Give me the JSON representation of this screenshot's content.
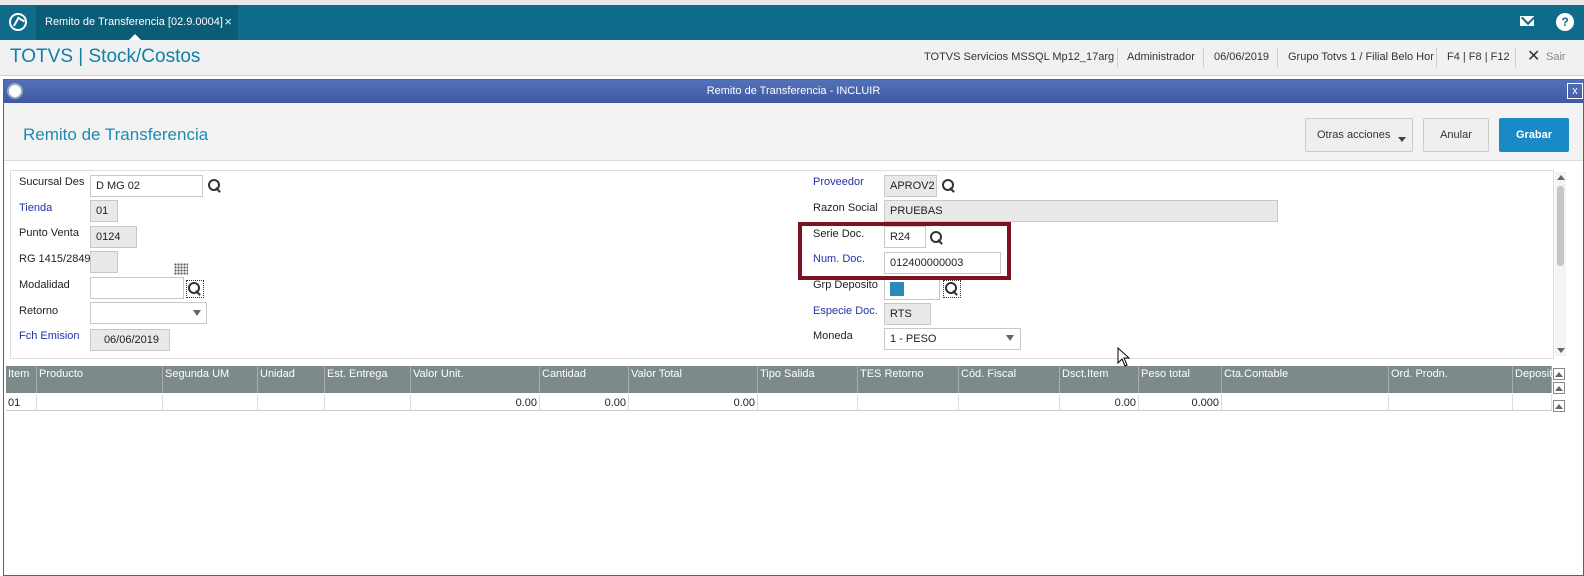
{
  "tabbar": {
    "tab_label": "Remito de Transferencia [02.9.0004]",
    "tab_close": "×"
  },
  "header": {
    "app_title": "TOTVS | Stock/Costos",
    "server": "TOTVS Servicios MSSQL Mp12_17arg",
    "user": "Administrador",
    "date": "06/06/2019",
    "branch": "Grupo Totvs 1 / Filial Belo Hor",
    "shortcuts": "F4 | F8 | F12",
    "exit_label": "Sair"
  },
  "window": {
    "title": "Remito de Transferencia - INCLUIR",
    "close": "x"
  },
  "form": {
    "title": "Remito de Transferencia",
    "buttons": {
      "otras": "Otras acciones",
      "anular": "Anular",
      "grabar": "Grabar"
    },
    "left": {
      "sucursal_label": "Sucursal Des",
      "sucursal_value": "D MG 02",
      "tienda_label": "Tienda",
      "tienda_value": "01",
      "punto_label": "Punto Venta",
      "punto_value": "0124",
      "rg_label": "RG 1415/2849",
      "modalidad_label": "Modalidad",
      "retorno_label": "Retorno",
      "fch_label": "Fch Emision",
      "fch_value": "06/06/2019"
    },
    "right": {
      "proveedor_label": "Proveedor",
      "proveedor_value": "APROV2",
      "razon_label": "Razon Social",
      "razon_value": "PRUEBAS",
      "serie_label": "Serie Doc.",
      "serie_value": "R24",
      "num_label": "Num. Doc.",
      "num_value": "012400000003",
      "grp_label": "Grp Deposito",
      "especie_label": "Especie Doc.",
      "especie_value": "RTS",
      "moneda_label": "Moneda",
      "moneda_value": "1 - PESO"
    }
  },
  "grid": {
    "columns": [
      "Item",
      "Producto",
      "Segunda UM",
      "Unidad",
      "Est. Entrega",
      "Valor Unit.",
      "Cantidad",
      "Valor Total",
      "Tipo Salida",
      "TES Retorno",
      "Cód. Fiscal",
      "Dsct.Item",
      "Peso total",
      "Cta.Contable",
      "Ord. Prodn.",
      "Deposito"
    ],
    "row": [
      "01",
      "",
      "",
      "",
      "",
      "0.00",
      "0.00",
      "0.00",
      "",
      "",
      "",
      "0.00",
      "0.000",
      "",
      "",
      ""
    ]
  },
  "colors": {
    "tabbar": "#0e6b8a",
    "accent": "#1d8bb5",
    "grabar": "#1a8ac7",
    "highlight": "#7a1224",
    "grid_header": "#7d8a8a"
  }
}
